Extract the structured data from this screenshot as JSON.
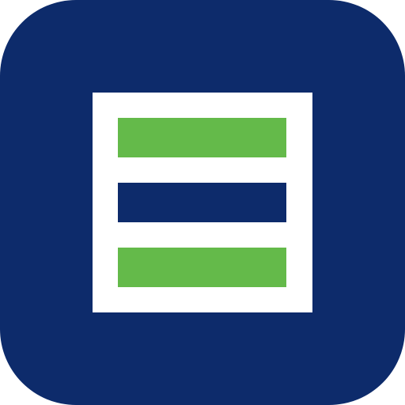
{
  "icon": {
    "name": "app-logo",
    "colors": {
      "navy": "#0d2b6b",
      "green": "#64ba4a",
      "white": "#ffffff"
    },
    "bars": [
      {
        "name": "bar-top",
        "color": "green"
      },
      {
        "name": "bar-middle",
        "color": "navy"
      },
      {
        "name": "bar-bottom",
        "color": "green"
      }
    ]
  }
}
